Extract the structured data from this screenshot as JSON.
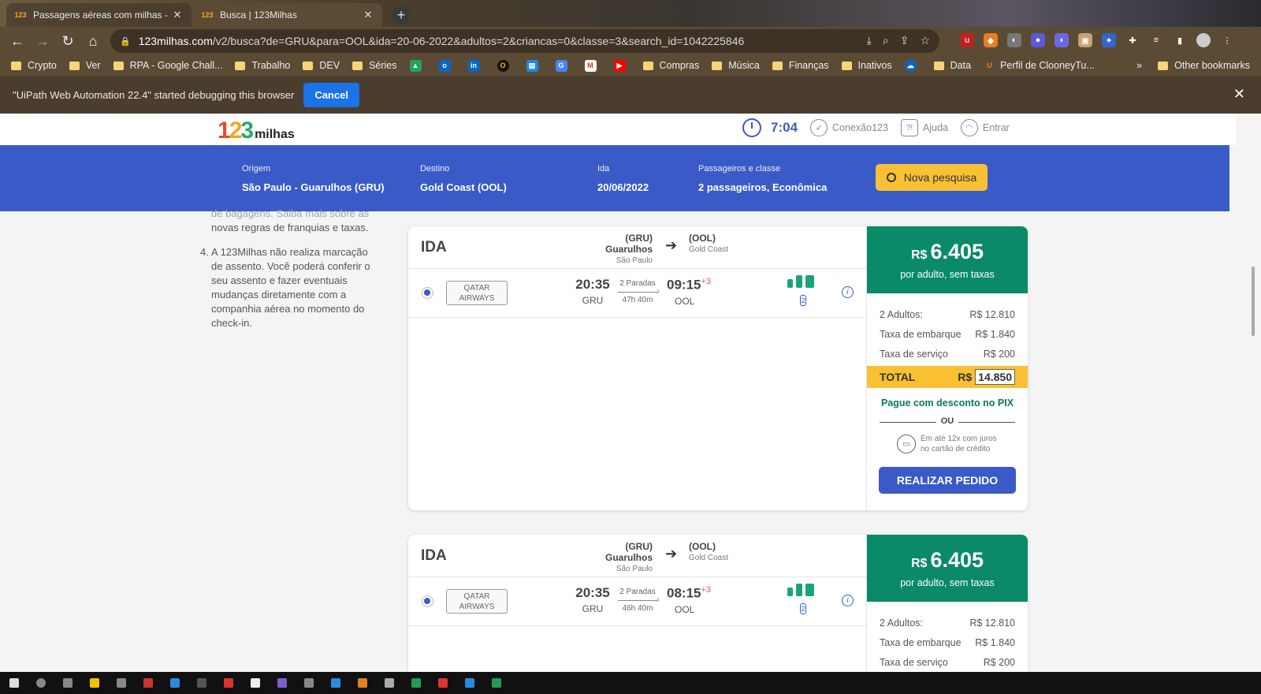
{
  "browser": {
    "tabs": [
      {
        "title": "Passagens aéreas com milhas - ",
        "favicon": "123"
      },
      {
        "title": "Busca | 123Milhas",
        "favicon": "123"
      }
    ],
    "url_host": "123milhas.com",
    "url_path": "/v2/busca?de=GRU&para=OOL&ida=20-06-2022&adultos=2&criancas=0&classe=3&search_id=1042225846",
    "bookmarks": [
      "Crypto",
      "Ver",
      "RPA - Google Chall...",
      "Trabalho",
      "DEV",
      "Séries",
      "Compras",
      "Música",
      "Finanças",
      "Inativos",
      "Data",
      "Perfil de ClooneyTu..."
    ],
    "other_bookmarks": "Other bookmarks",
    "debug_message": "\"UiPath Web Automation 22.4\" started debugging this browser",
    "debug_cancel": "Cancel"
  },
  "header": {
    "logo_digits": [
      "1",
      "2",
      "3"
    ],
    "logo_text": "milhas",
    "timer": "7:04",
    "links": [
      "Conexão123",
      "Ajuda",
      "Entrar"
    ]
  },
  "search": {
    "origem_label": "Origem",
    "origem": "São Paulo - Guarulhos (GRU)",
    "destino_label": "Destino",
    "destino": "Gold Coast (OOL)",
    "ida_label": "Ida",
    "ida": "20/06/2022",
    "pass_label": "Passageiros e classe",
    "pass": "2 passageiros, Econômica",
    "button": "Nova pesquisa"
  },
  "sidebar": {
    "faded_line1": "de bagagens. Saiba mais sobre as",
    "faded_line2": "novas regras de franquias e taxas.",
    "item4_number": "4.",
    "item4_lines": [
      "A 123Milhas não realiza marcação",
      "de assento. Você poderá conferir o",
      "seu assento e fazer eventuais",
      "mudanças diretamente com a",
      "companhia aérea no momento do",
      "check-in."
    ]
  },
  "cards": [
    {
      "title": "IDA",
      "origin_code": "(GRU) Guarulhos",
      "origin_city": "São Paulo",
      "dest_code": "(OOL)",
      "dest_city": "Gold Coast",
      "airline_line1": "QATAR",
      "airline_line2": "AIRWAYS",
      "dep_time": "20:35",
      "dep_code": "GRU",
      "stops": "2 Paradas",
      "duration": "47h 40m",
      "arr_time": "09:15",
      "arr_offset": "+3",
      "arr_code": "OOL",
      "bag_count": "2",
      "currency": "R$",
      "price": "6.405",
      "price_sub": "por adulto, sem taxas",
      "breakdown": [
        {
          "label": "2 Adultos:",
          "value": "R$ 12.810"
        },
        {
          "label": "Taxa de embarque",
          "value": "R$ 1.840"
        },
        {
          "label": "Taxa de serviço",
          "value": "R$ 200"
        }
      ],
      "total_label": "TOTAL",
      "total_currency": "R$",
      "total_value": "14.850",
      "pix": "Pague com desconto no PIX",
      "ou": "OU",
      "credit_line1": "Em até 12x com juros",
      "credit_line2": "no cartão de crédito",
      "cta": "REALIZAR PEDIDO"
    },
    {
      "title": "IDA",
      "origin_code": "(GRU) Guarulhos",
      "origin_city": "São Paulo",
      "dest_code": "(OOL)",
      "dest_city": "Gold Coast",
      "airline_line1": "QATAR",
      "airline_line2": "AIRWAYS",
      "dep_time": "20:35",
      "dep_code": "GRU",
      "stops": "2 Paradas",
      "duration": "46h 40m",
      "arr_time": "08:15",
      "arr_offset": "+3",
      "arr_code": "OOL",
      "bag_count": "2",
      "currency": "R$",
      "price": "6.405",
      "price_sub": "por adulto, sem taxas",
      "breakdown": [
        {
          "label": "2 Adultos:",
          "value": "R$ 12.810"
        },
        {
          "label": "Taxa de embarque",
          "value": "R$ 1.840"
        },
        {
          "label": "Taxa de serviço",
          "value": "R$ 200"
        }
      ]
    }
  ],
  "colors": {
    "brand_blue": "#3a5bc7",
    "price_green": "#0a8a68",
    "accent_yellow": "#f9c033"
  }
}
